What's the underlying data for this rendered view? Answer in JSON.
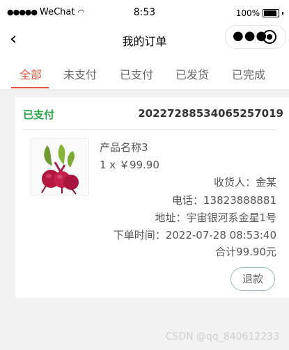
{
  "status_bar": {
    "carrier": "WeChat",
    "time": "8:53",
    "battery": "100%"
  },
  "nav": {
    "title": "我的订单",
    "back_icon": "chevron-left-icon",
    "more_icon": "more-dots-icon",
    "close_icon": "target-icon"
  },
  "tabs": [
    {
      "label": "全部",
      "active": true
    },
    {
      "label": "未支付"
    },
    {
      "label": "已支付"
    },
    {
      "label": "已发货"
    },
    {
      "label": "已完成"
    }
  ],
  "order": {
    "status": "已支付",
    "number": "20227288534065257019",
    "product_name": "产品名称3",
    "quantity_price": "1 x ￥99.90",
    "recipient_line": "收货人：金某",
    "phone_line": "电话：13823888881",
    "address_line": "地址：宇宙银河系金星1号",
    "order_time_line": "下单时间：2022-07-28 08:53:40",
    "total_line": "合计99.90元",
    "refund_label": "退款"
  },
  "watermark": "CSDN @qq_840612233",
  "colors": {
    "accent": "#e5533d",
    "paid_status": "#28a745"
  }
}
